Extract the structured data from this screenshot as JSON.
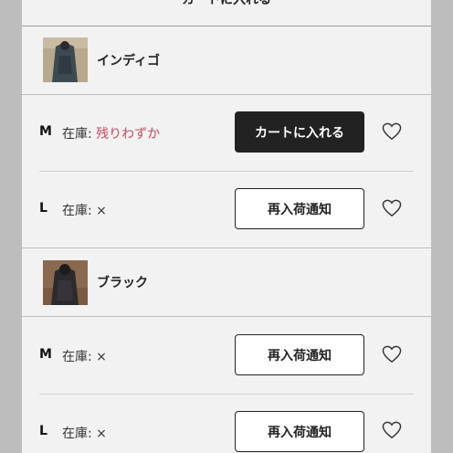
{
  "top": {
    "button_label": "カートに入れる"
  },
  "variants": [
    {
      "color_name": "インディゴ",
      "rows": [
        {
          "size": "M",
          "stock_label": "在庫:",
          "stock_value": "残りわずか",
          "button_label": "カートに入れる"
        },
        {
          "size": "L",
          "stock_label": "在庫:",
          "stock_value": "×",
          "button_label": "再入荷通知"
        }
      ]
    },
    {
      "color_name": "ブラック",
      "rows": [
        {
          "size": "M",
          "stock_label": "在庫:",
          "stock_value": "×",
          "button_label": "再入荷通知"
        },
        {
          "size": "L",
          "stock_label": "在庫:",
          "stock_value": "×",
          "button_label": "再入荷通知"
        }
      ]
    }
  ],
  "colors": {
    "accent_low_stock": "#c44a5e",
    "button_dark": "#222222"
  },
  "icons": {
    "favorite": "heart-outline-icon"
  }
}
